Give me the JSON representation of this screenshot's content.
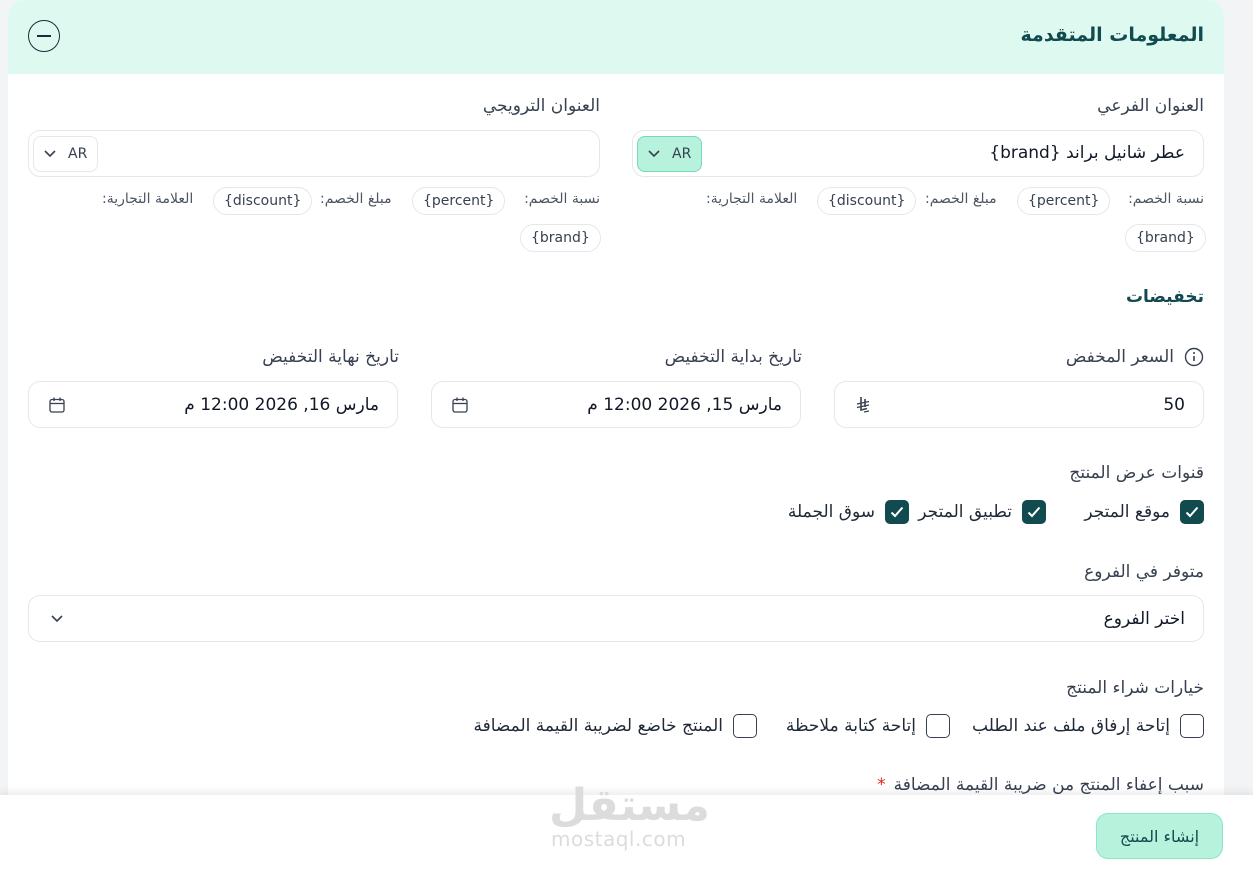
{
  "header": {
    "title": "المعلومات المتقدمة"
  },
  "subtitle_field": {
    "label": "العنوان الفرعي",
    "value": "عطر شانيل براند {brand}",
    "lang": "AR",
    "hints": {
      "percent_label": "نسبة الخصم:",
      "percent_tag": "{percent}",
      "discount_label": "مبلغ الخصم:",
      "discount_tag": "{discount}",
      "brand_label": "العلامة التجارية:",
      "brand_tag": "{brand}"
    }
  },
  "promo_field": {
    "label": "العنوان الترويجي",
    "value": "",
    "lang": "AR",
    "hints": {
      "percent_label": "نسبة الخصم:",
      "percent_tag": "{percent}",
      "discount_label": "مبلغ الخصم:",
      "discount_tag": "{discount}",
      "brand_label": "العلامة التجارية:",
      "brand_tag": "{brand}"
    }
  },
  "discounts": {
    "title": "تخفيضات",
    "price_label": "السعر المخفض",
    "price_value": "50",
    "currency_icon": "riyal-icon",
    "start_label": "تاريخ بداية التخفيض",
    "start_value": "مارس 15, 2026 12:00 م",
    "end_label": "تاريخ نهاية التخفيض",
    "end_value": "مارس 16, 2026 12:00 م"
  },
  "channels": {
    "label": "قنوات عرض المنتج",
    "items": [
      {
        "label": "موقع المتجر",
        "checked": true
      },
      {
        "label": "تطبيق المتجر",
        "checked": true
      },
      {
        "label": "سوق الجملة",
        "checked": true
      }
    ]
  },
  "branches": {
    "label": "متوفر في الفروع",
    "placeholder": "اختر الفروع"
  },
  "purchase_options": {
    "label": "خيارات شراء المنتج",
    "items": [
      {
        "label": "إتاحة إرفاق ملف عند الطلب",
        "checked": false
      },
      {
        "label": "إتاحة كتابة ملاحظة",
        "checked": false
      },
      {
        "label": "المنتج خاضع لضريبة القيمة المضافة",
        "checked": false
      }
    ]
  },
  "vat_exempt": {
    "label": "سبب إعفاء المنتج من ضريبة القيمة المضافة",
    "required_mark": "*"
  },
  "footer": {
    "create_button": "إنشاء المنتج"
  },
  "watermark": {
    "arabic": "مستقل",
    "latin": "mostaql.com"
  },
  "colors": {
    "accent": "#114a4f",
    "mint": "#b7f2dd",
    "header_bg": "#defaf0",
    "required": "#dc2626"
  }
}
